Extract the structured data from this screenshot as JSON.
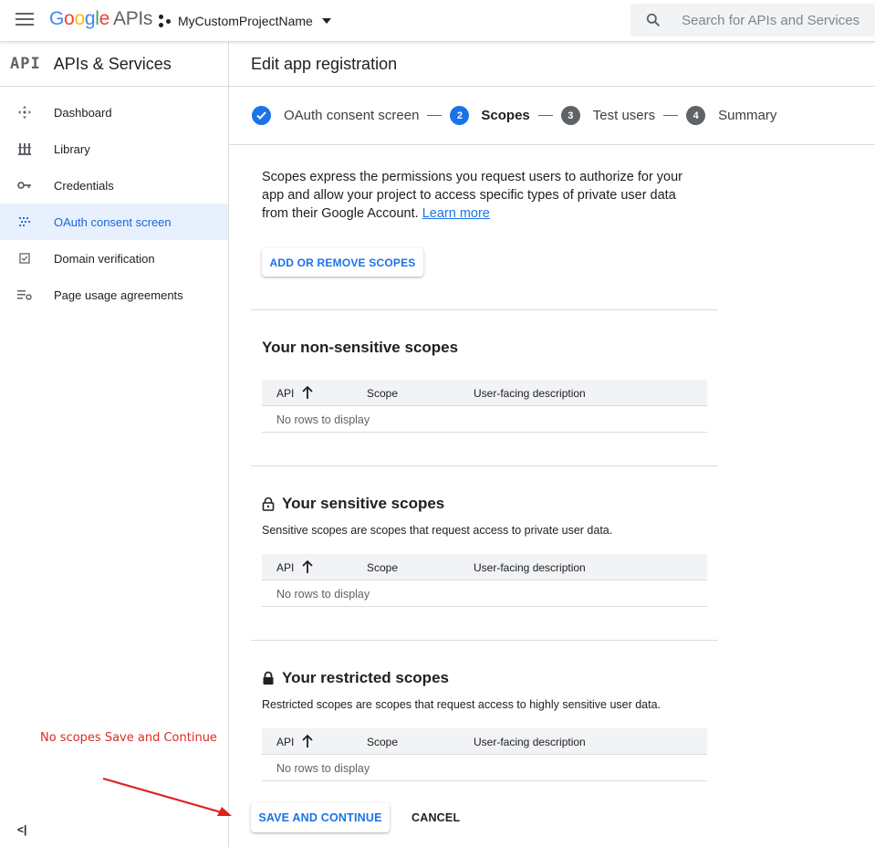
{
  "topbar": {
    "logo_google": [
      "G",
      "o",
      "o",
      "g",
      "l",
      "e"
    ],
    "logo_apis": "APIs",
    "project_name": "MyCustomProjectName",
    "search_placeholder": "Search for APIs and Services"
  },
  "sidebar": {
    "mark": "API",
    "title": "APIs & Services",
    "items": [
      {
        "label": "Dashboard",
        "icon": "dashboard-icon"
      },
      {
        "label": "Library",
        "icon": "library-icon"
      },
      {
        "label": "Credentials",
        "icon": "key-icon"
      },
      {
        "label": "OAuth consent screen",
        "icon": "oauth-consent-icon",
        "active": true
      },
      {
        "label": "Domain verification",
        "icon": "checkbox-icon"
      },
      {
        "label": "Page usage agreements",
        "icon": "list-settings-icon"
      }
    ],
    "collapse": "<|"
  },
  "main": {
    "title": "Edit app registration",
    "steps": [
      {
        "num": "",
        "label": "OAuth consent screen",
        "state": "done"
      },
      {
        "num": "2",
        "label": "Scopes",
        "state": "current"
      },
      {
        "num": "3",
        "label": "Test users",
        "state": "todo"
      },
      {
        "num": "4",
        "label": "Summary",
        "state": "todo"
      }
    ],
    "intro": "Scopes express the permissions you request users to authorize for your app and allow your project to access specific types of private user data from their Google Account.",
    "learn_more": "Learn more",
    "add_scopes_button": "ADD OR REMOVE SCOPES",
    "table_headers": {
      "api": "API",
      "scope": "Scope",
      "desc": "User-facing description"
    },
    "empty_text": "No rows to display",
    "non_sensitive": {
      "title": "Your non-sensitive scopes"
    },
    "sensitive": {
      "title": "Your sensitive scopes",
      "desc": "Sensitive scopes are scopes that request access to private user data."
    },
    "restricted": {
      "title": "Your restricted scopes",
      "desc": "Restricted scopes are scopes that request access to highly sensitive user data."
    },
    "save_button": "SAVE AND CONTINUE",
    "cancel_button": "CANCEL"
  },
  "annotation": {
    "text": "No scopes Save and Continue",
    "color": "#d92d20"
  },
  "colors": {
    "accent": "#1a73e8",
    "active_bg": "#e8f0fe"
  }
}
